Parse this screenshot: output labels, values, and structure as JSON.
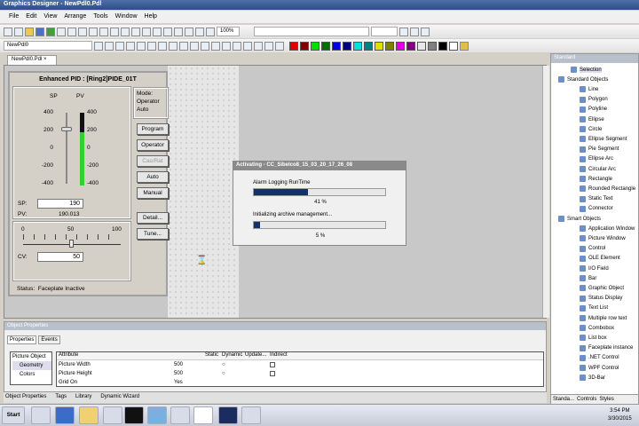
{
  "window": {
    "title": "Graphics Designer - NewPdl0.Pdl"
  },
  "menu": [
    "File",
    "Edit",
    "View",
    "Arrange",
    "Tools",
    "Window",
    "Help"
  ],
  "toolbar": {
    "zoom": "100%",
    "object_select": "NewPdl0"
  },
  "palette": [
    "#e00000",
    "#800000",
    "#00e000",
    "#007000",
    "#0000e0",
    "#000080",
    "#00e0e0",
    "#008080",
    "#e0e000",
    "#808000",
    "#e000e0",
    "#800080",
    "#e8e8e8",
    "#808080",
    "#000000",
    "#ffffff"
  ],
  "doc_tab": {
    "label": "NewPdl0.Pdl",
    "close": "×"
  },
  "faceplate": {
    "title": "Enhanced PID : [Ring2]PIDE_01T",
    "sp_label": "SP",
    "pv_label": "PV",
    "scale": [
      "400",
      "200",
      "0",
      "-200",
      "-400"
    ],
    "pv_level_percent": 73,
    "mode_lines": [
      "Mode:",
      "Operator",
      "Auto"
    ],
    "buttons": [
      "Program",
      "Operator",
      "Cas/Rat",
      "Auto",
      "Manual",
      "Detail...",
      "Tune..."
    ],
    "sp_field_label": "SP:",
    "sp_value": "190",
    "pv_field_label": "PV:",
    "pv_value": "190.013",
    "cv_scale": [
      "0",
      "50",
      "100"
    ],
    "cv_slider_percent": 50,
    "cv_label": "CV:",
    "cv_value": "50",
    "status_label": "Status:",
    "status_value": "Faceplate Inactive"
  },
  "dialog": {
    "title": "Activating - CC_Sibelco8_15_03_20_17_26_08",
    "task1": "Alarm Logging RunTime",
    "progress1": 41,
    "progress1_text": "41 %",
    "task2": "Initializing archive management...",
    "progress2": 5,
    "progress2_text": "5 %"
  },
  "panel": {
    "title": "Standard",
    "selection": "Selection",
    "groups": [
      {
        "label": "Standard Objects",
        "items": [
          "Line",
          "Polygon",
          "Polyline",
          "Ellipse",
          "Circle",
          "Ellipse Segment",
          "Pie Segment",
          "Ellipse Arc",
          "Circular Arc",
          "Rectangle",
          "Rounded Rectangle",
          "Static Text",
          "Connector"
        ]
      },
      {
        "label": "Smart Objects",
        "items": [
          "Application Window",
          "Picture Window",
          "Control",
          "OLE Element",
          "I/O Field",
          "Bar",
          "Graphic Object",
          "Status Display",
          "Text List",
          "Multiple row text",
          "Combobox",
          "List box",
          "Faceplate instance",
          ".NET Control",
          "WPF Control",
          "3D-Bar"
        ]
      }
    ],
    "tabs": [
      "Standa...",
      "Controls",
      "Styles"
    ]
  },
  "properties": {
    "title": "Object Properties",
    "tabs": [
      "Properties",
      "Events"
    ],
    "tree": [
      "Picture Object",
      "Geometry",
      "Colors"
    ],
    "columns": [
      "Attribute",
      "Static",
      "Dynamic",
      "Update...",
      "Indirect"
    ],
    "rows": [
      [
        "Picture Width",
        "500"
      ],
      [
        "Picture Height",
        "500"
      ],
      [
        "Grid On",
        "Yes"
      ]
    ]
  },
  "bottom_tabs": [
    "Object Properties",
    "Tags",
    "Library",
    "Dynamic Wizard"
  ],
  "taskbar": {
    "start": "Start",
    "time": "3:54 PM",
    "date": "3/30/2015"
  }
}
